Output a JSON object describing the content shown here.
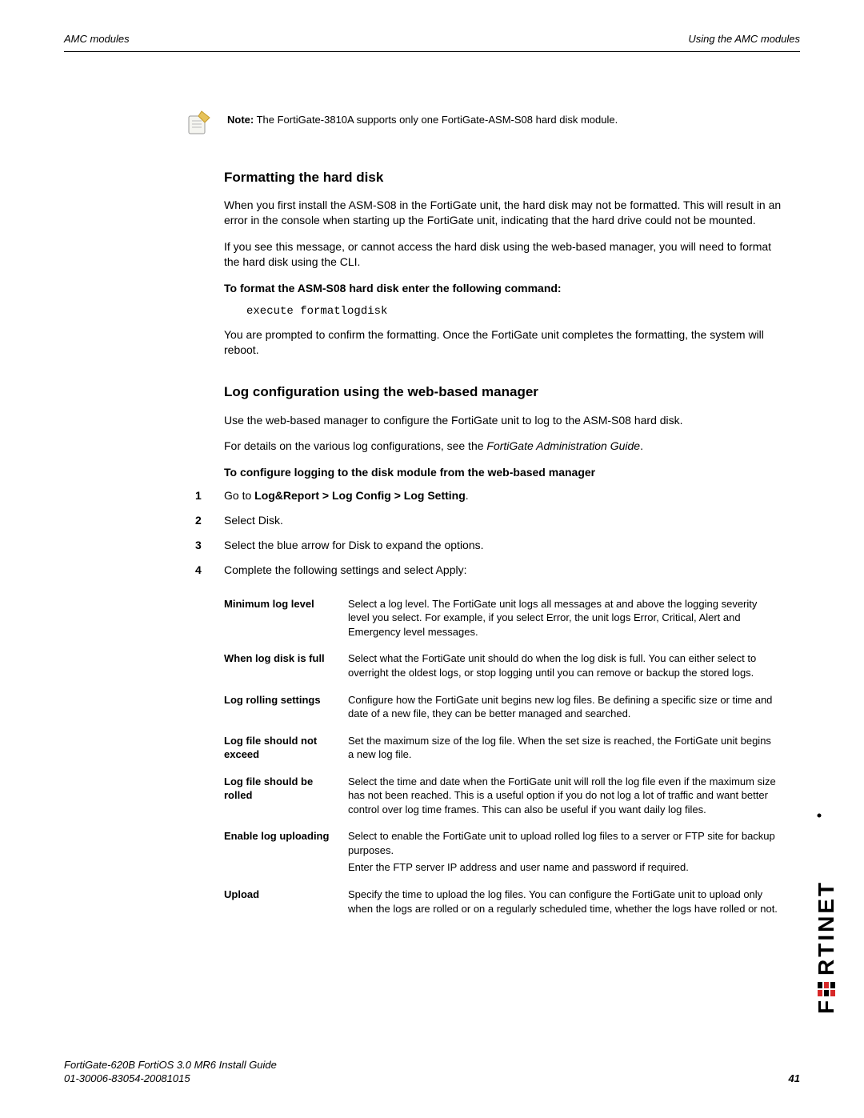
{
  "header": {
    "left": "AMC modules",
    "right": "Using the AMC modules"
  },
  "note": {
    "label": "Note:",
    "text": " The FortiGate-3810A supports only one FortiGate-ASM-S08 hard disk module."
  },
  "section1": {
    "title": "Formatting the hard disk",
    "p1": "When you first install the ASM-S08 in the FortiGate unit, the hard disk may not be formatted. This will result in an error in the console when starting up the FortiGate unit, indicating that the hard drive could not be mounted.",
    "p2": "If you see this message, or cannot access the hard disk using the web-based manager, you will need to format the hard disk using the CLI.",
    "instr": "To format the ASM-S08 hard disk enter the following command:",
    "cmd": "execute formatlogdisk",
    "p3": "You are prompted to confirm the formatting. Once the FortiGate unit completes the formatting, the system will reboot."
  },
  "section2": {
    "title": "Log configuration using the web-based manager",
    "p1": "Use the web-based manager to configure the FortiGate unit to log to the ASM-S08 hard disk.",
    "p2a": "For details on the various log configurations, see the ",
    "p2b": "FortiGate Administration Guide",
    "p2c": ".",
    "instr": "To configure logging to the disk module from the web-based manager",
    "steps": {
      "s1a": "Go to ",
      "s1b": "Log&Report > Log Config > Log Setting",
      "s1c": ".",
      "s2": "Select Disk.",
      "s3": "Select the blue arrow for Disk to expand the options.",
      "s4": "Complete the following settings and select Apply:"
    },
    "settings": [
      {
        "label": "Minimum log level",
        "desc1": "Select a log level. The FortiGate unit logs all messages at and above the logging severity level you select. For example, if you select Error, the unit logs Error, Critical, Alert and Emergency level messages."
      },
      {
        "label": "When log disk is full",
        "desc1": "Select what the FortiGate unit should do when the log disk is full. You can either select to overright the oldest logs, or stop logging until you can remove or backup the stored logs."
      },
      {
        "label": "Log rolling settings",
        "desc1": "Configure how the FortiGate unit begins new log files. Be defining a specific size or time and date of a new file, they can be better managed and searched."
      },
      {
        "label": "Log file should not exceed",
        "desc1": "Set the maximum size of the log file. When the set size is reached, the FortiGate unit begins a new log file."
      },
      {
        "label": "Log file should be rolled",
        "desc1": "Select the time and date when the FortiGate unit will roll the log file even if the maximum size has not been reached. This is a useful option if you do not log a lot of traffic and want better control over log time frames. This can also be useful if you want daily log files."
      },
      {
        "label": "Enable log uploading",
        "desc1": "Select to enable the FortiGate unit to upload rolled log files to a server or FTP site for backup purposes.",
        "desc2": "Enter the FTP server IP address and user name and password if required."
      },
      {
        "label": "Upload",
        "desc1": "Specify the time to upload the log files. You can configure the FortiGate unit to upload only when the logs are rolled or on a regularly scheduled time, whether the logs have rolled or not."
      }
    ]
  },
  "footer": {
    "line1": "FortiGate-620B FortiOS 3.0 MR6 Install Guide",
    "line2": "01-30006-83054-20081015",
    "page": "41"
  },
  "brand": "FORTINET",
  "stepnums": {
    "n1": "1",
    "n2": "2",
    "n3": "3",
    "n4": "4"
  }
}
